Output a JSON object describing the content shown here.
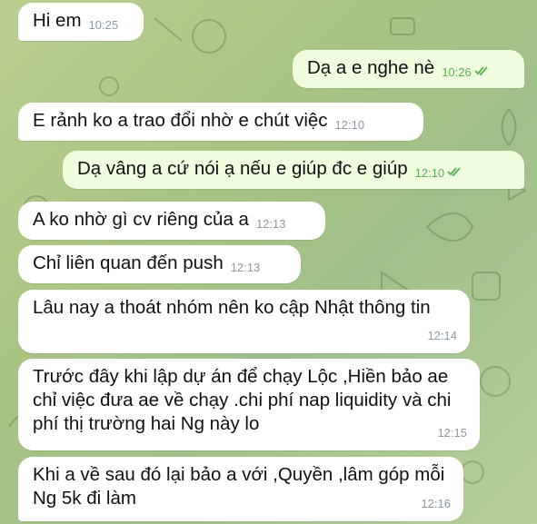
{
  "chat": {
    "messages": [
      {
        "direction": "in",
        "text": "Hi em",
        "time": "10:25"
      },
      {
        "direction": "out",
        "text": "Dạ a e nghe nè",
        "time": "10:26",
        "status": "read"
      },
      {
        "direction": "in",
        "text": "E rảnh ko a trao đổi nhờ e chút việc",
        "time": "12:10"
      },
      {
        "direction": "out",
        "text": "Dạ vâng a cứ nói ạ nếu e giúp đc e giúp",
        "time": "12:10",
        "status": "read"
      },
      {
        "direction": "in",
        "text": "A ko nhờ gì cv riêng của a",
        "time": "12:13"
      },
      {
        "direction": "in",
        "text": "Chỉ liên quan đến push",
        "time": "12:13"
      },
      {
        "direction": "in",
        "text": "Lâu nay a thoát nhóm nên ko cập Nhật thông tin",
        "time": "12:14"
      },
      {
        "direction": "in",
        "text": "Trước đây khi lập dự án để chạy Lộc ,Hiền bảo ae chỉ việc đưa ae về chạy .chi phí nap liquidity và chi phí thị trường hai Ng này lo",
        "time": "12:15"
      },
      {
        "direction": "in",
        "text": "Khi a về sau đó lại bảo a với ,Quyền ,lâm góp mỗi Ng 5k đi làm",
        "time": "12:16"
      }
    ]
  },
  "colors": {
    "incoming_bubble": "#ffffff",
    "outgoing_bubble": "#effdde",
    "outgoing_time": "#5cae4e",
    "incoming_time": "#8e9aa3",
    "wallpaper": "#a9c583"
  },
  "icons": {
    "read_status": "double-check-icon"
  }
}
